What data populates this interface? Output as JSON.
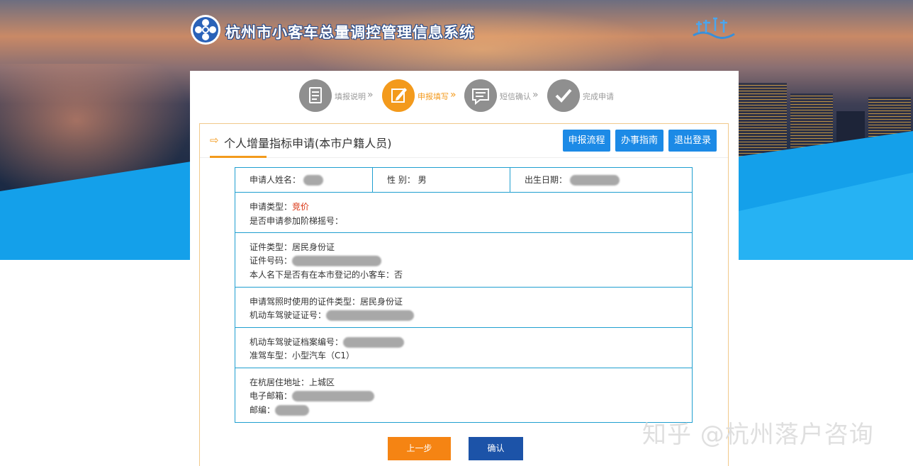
{
  "header": {
    "site_title": "杭州市小客车总量调控管理信息系统"
  },
  "steps": [
    {
      "label": "填报说明",
      "icon": "document-icon",
      "active": false
    },
    {
      "label": "申报填写",
      "icon": "edit-icon",
      "active": true
    },
    {
      "label": "短信确认",
      "icon": "message-icon",
      "active": false
    },
    {
      "label": "完成申请",
      "icon": "check-icon",
      "active": false
    }
  ],
  "form": {
    "title": "个人增量指标申请(本市户籍人员)",
    "buttons": {
      "process": "申报流程",
      "guide": "办事指南",
      "logout": "退出登录"
    }
  },
  "info": {
    "applicant_name_label": "申请人姓名：",
    "gender_label": "性  别：",
    "gender_value": "男",
    "birth_label": "出生日期：",
    "apply_type_label": "申请类型：",
    "apply_type_value": "竞价",
    "ladder_label": "是否申请参加阶梯摇号：",
    "id_type_label": "证件类型：",
    "id_type_value": "居民身份证",
    "id_number_label": "证件号码：",
    "owns_car_label": "本人名下是否有在本市登记的小客车：",
    "owns_car_value": "否",
    "license_id_type_label": "申请驾照时使用的证件类型：",
    "license_id_type_value": "居民身份证",
    "license_number_label": "机动车驾驶证证号：",
    "license_file_label": "机动车驾驶证档案编号：",
    "vehicle_class_label": "准驾车型：",
    "vehicle_class_value": "小型汽车（C1）",
    "address_label": "在杭居住地址：",
    "address_value": "上城区",
    "email_label": "电子邮箱：",
    "zip_label": "邮编："
  },
  "actions": {
    "prev": "上一步",
    "confirm": "确认"
  },
  "watermark": "知乎 @杭州落户咨询",
  "colors": {
    "accent_orange": "#f39a1c",
    "button_blue": "#1c8ae6",
    "confirm_blue": "#1c53a8",
    "prev_orange": "#f58413",
    "table_border": "#1f9fd0",
    "value_red": "#d9300e"
  }
}
